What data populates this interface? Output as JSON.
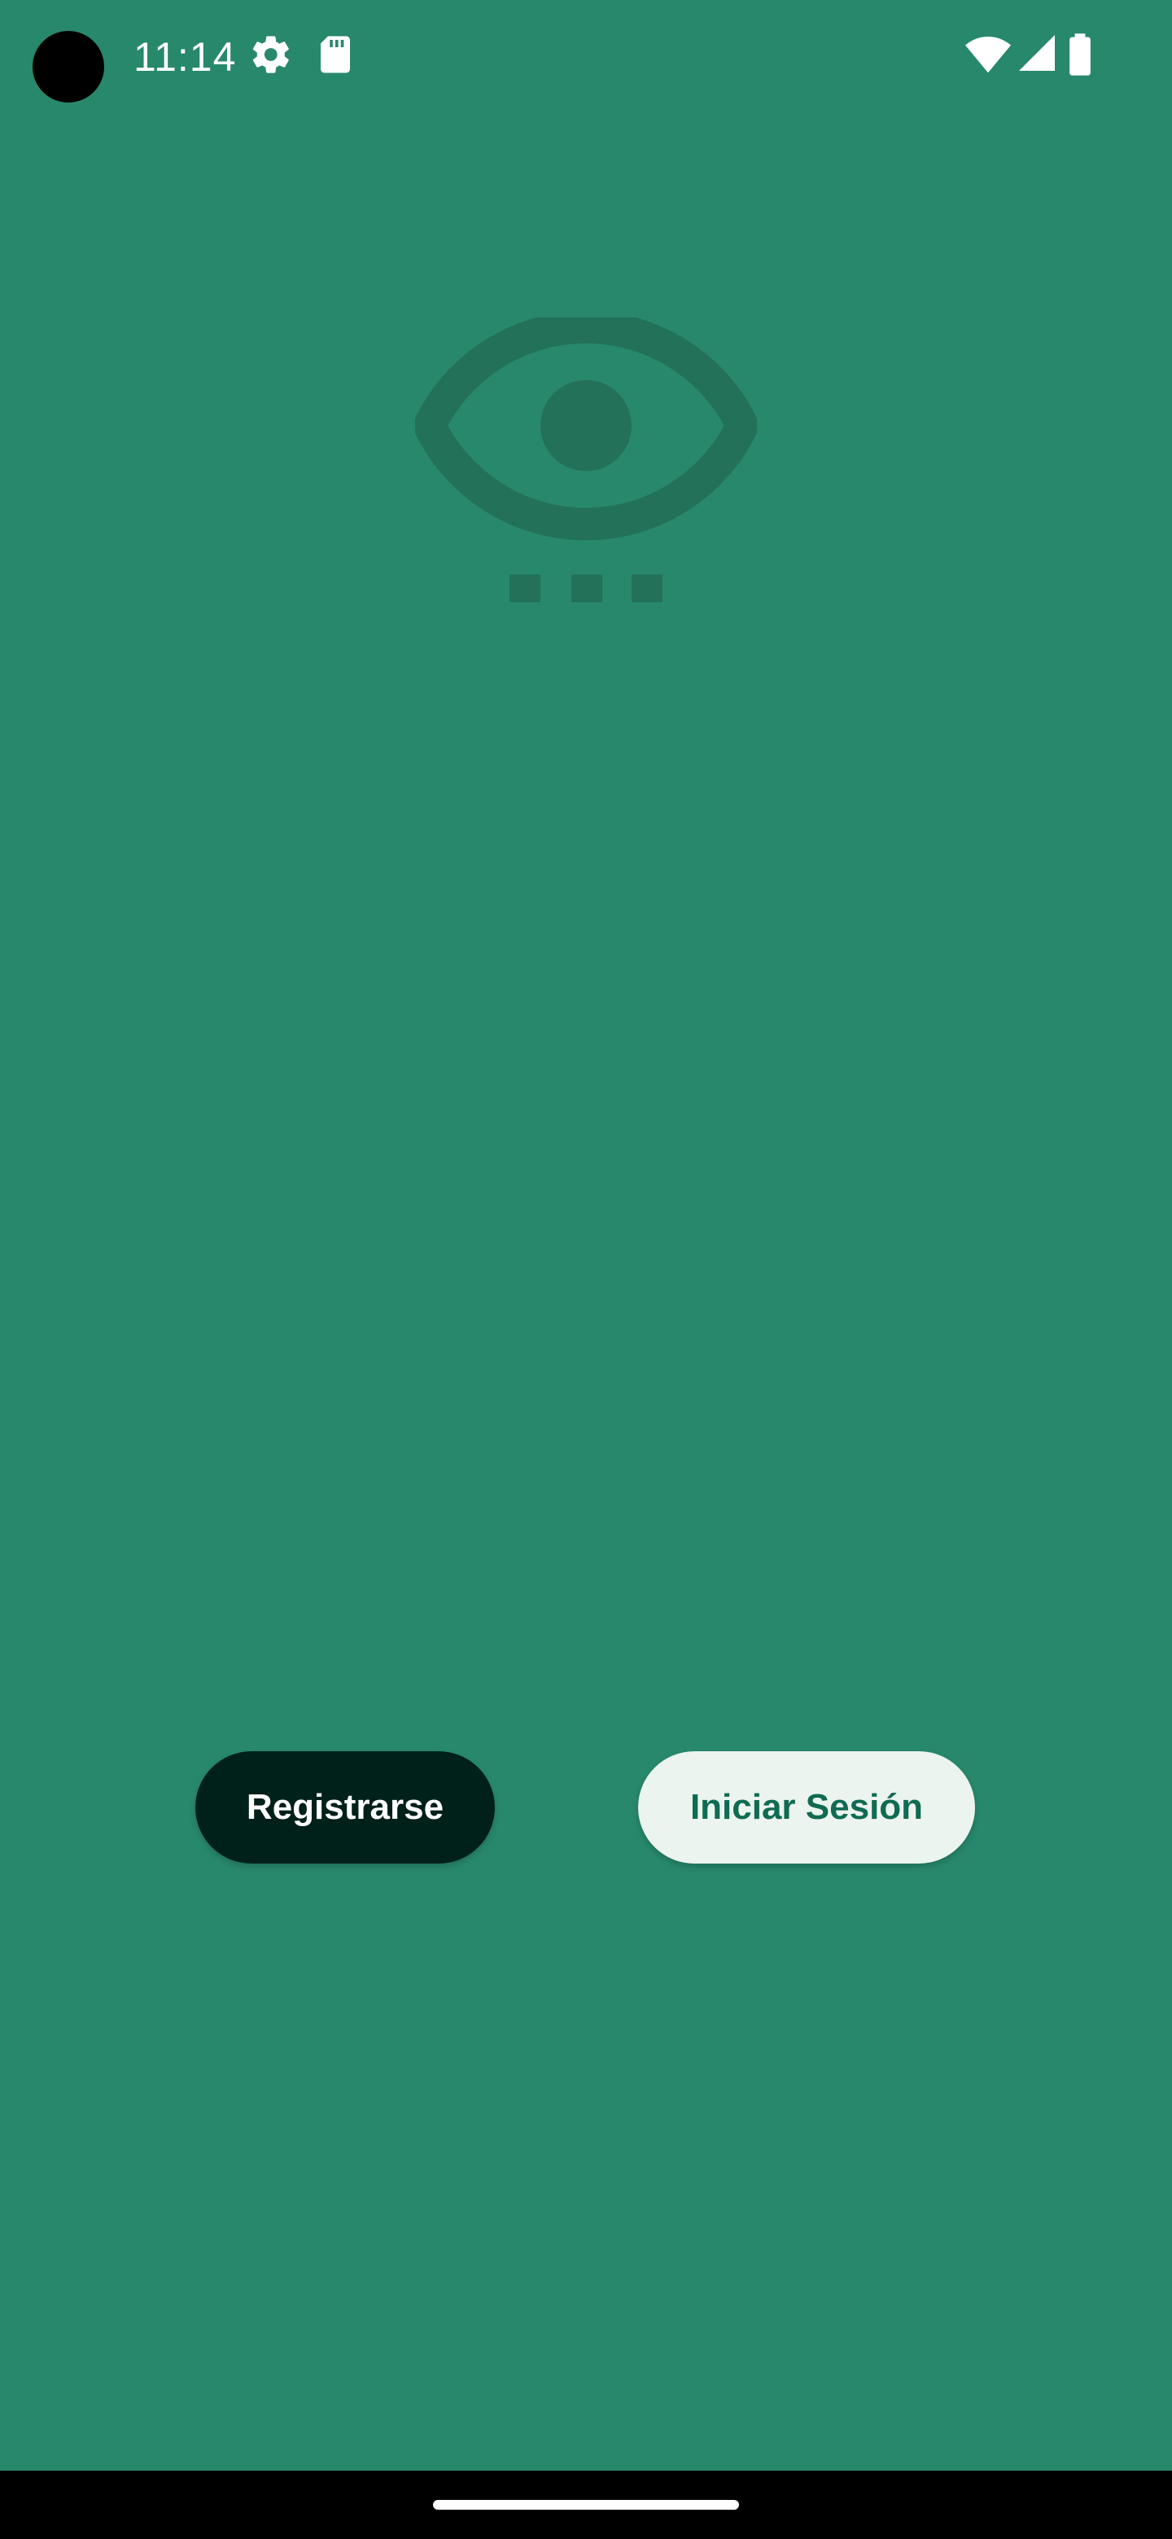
{
  "status_bar": {
    "time": "11:14",
    "icons": [
      "settings-gear-icon",
      "sd-card-icon",
      "wifi-icon",
      "cell-signal-icon",
      "battery-icon"
    ]
  },
  "logo": {
    "icon": "eye-icon"
  },
  "actions": {
    "register_label": "Registrarse",
    "login_label": "Iniciar Sesión"
  },
  "colors": {
    "background": "#28886c",
    "logo": "#237159",
    "register_button": "#00201a",
    "login_button": "#ecf4ef",
    "login_text": "#0f6b51"
  }
}
